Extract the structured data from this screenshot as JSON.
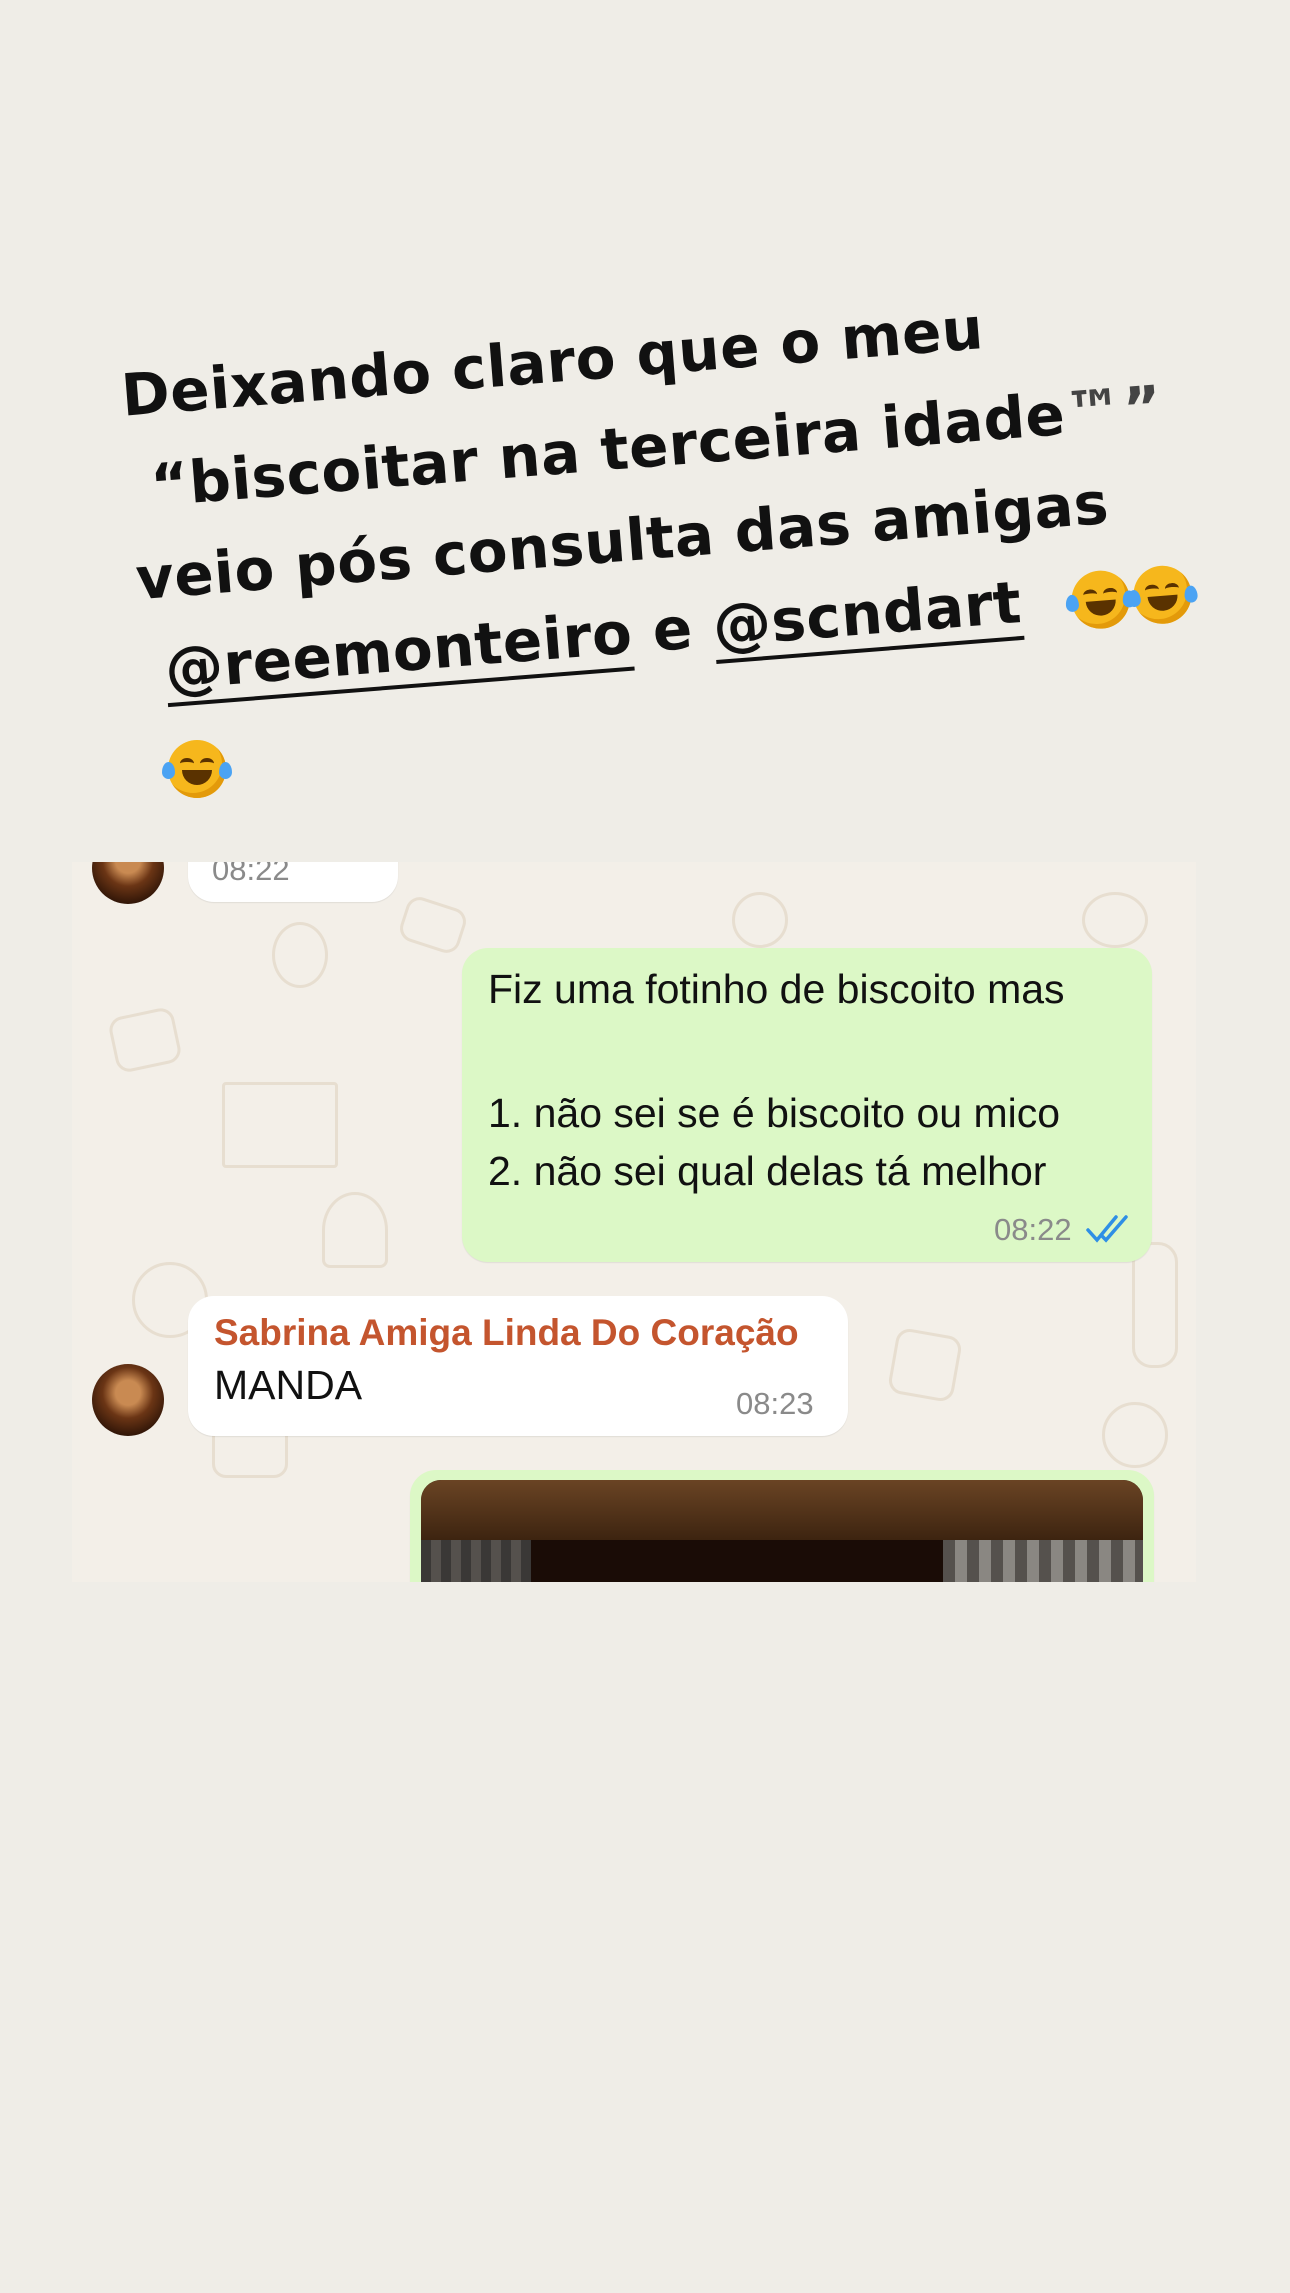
{
  "caption": {
    "line1": "Deixando claro que o meu",
    "line2_text": "“biscoitar na terceira idade",
    "line2_tm": "™”",
    "line3": "veio pós consulta das amigas",
    "mention1": "@reemonteiro",
    "connector": "e",
    "mention2": "@scndart",
    "emoji_name": "face-with-tears-of-joy"
  },
  "chat": {
    "top_partial_time": "08:22",
    "outgoing_message": {
      "line1": "Fiz uma fotinho de biscoito mas",
      "line2": "1. não sei se é biscoito ou mico",
      "line3": "2. não sei qual delas tá melhor",
      "time": "08:22",
      "status_icon": "double-check-read-icon",
      "status_color": "#2f8fe5"
    },
    "incoming_message": {
      "sender": "Sabrina Amiga Linda Do Coração",
      "text": "MANDA",
      "time": "08:23",
      "sender_color": "#c4552e"
    },
    "outgoing_bubble_color": "#dcf8c6",
    "incoming_bubble_color": "#ffffff"
  }
}
